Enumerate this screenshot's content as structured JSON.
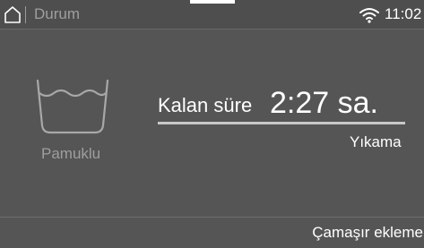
{
  "status_bar": {
    "home_icon": "home-icon",
    "section_title": "Durum",
    "wifi_icon": "wifi-icon",
    "time": "11:02"
  },
  "program": {
    "icon": "washtub-icon",
    "name": "Pamuklu"
  },
  "remaining": {
    "label": "Kalan süre",
    "value": "2:27 sa.",
    "progress_fraction": 0.0
  },
  "phase": "Yıkama",
  "actions": {
    "add_laundry": "Çamaşır ekleme"
  },
  "colors": {
    "background": "#555555",
    "text_primary": "#ffffff",
    "text_secondary": "#9e9e9e"
  }
}
